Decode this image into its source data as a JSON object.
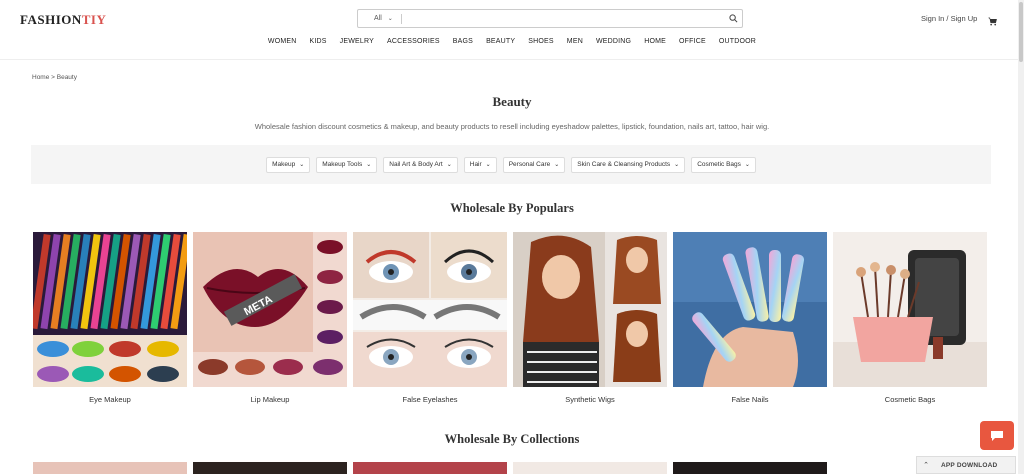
{
  "logo": {
    "main": "FASHION",
    "accent": "TIY"
  },
  "search": {
    "category": "All",
    "placeholder": ""
  },
  "account": {
    "label": "Sign In / Sign Up"
  },
  "nav": [
    "WOMEN",
    "KIDS",
    "JEWELRY",
    "ACCESSORIES",
    "BAGS",
    "BEAUTY",
    "SHOES",
    "MEN",
    "WEDDING",
    "HOME",
    "OFFICE",
    "OUTDOOR"
  ],
  "breadcrumb": "Home > Beauty",
  "page": {
    "title": "Beauty",
    "description": "Wholesale fashion discount cosmetics & makeup, and beauty products to resell including eyeshadow palettes, lipstick, foundation, nails art, tattoo, hair wig."
  },
  "filters": [
    "Makeup",
    "Makeup Tools",
    "Nail Art & Body Art",
    "Hair",
    "Personal Care",
    "Skin Care & Cleansing Products",
    "Cosmetic Bags"
  ],
  "sections": {
    "populars": "Wholesale By Populars",
    "collections": "Wholesale By Collections"
  },
  "populars": [
    {
      "label": "Eye Makeup",
      "icon": "eye-makeup-image"
    },
    {
      "label": "Lip Makeup",
      "icon": "lip-makeup-image"
    },
    {
      "label": "False Eyelashes",
      "icon": "false-eyelashes-image"
    },
    {
      "label": "Synthetic Wigs",
      "icon": "synthetic-wigs-image"
    },
    {
      "label": "False Nails",
      "icon": "false-nails-image"
    },
    {
      "label": "Cosmetic Bags",
      "icon": "cosmetic-bags-image"
    }
  ],
  "app_download": "APP DOWNLOAD",
  "colors": {
    "accent": "#d9534f",
    "chat": "#e8573f"
  }
}
